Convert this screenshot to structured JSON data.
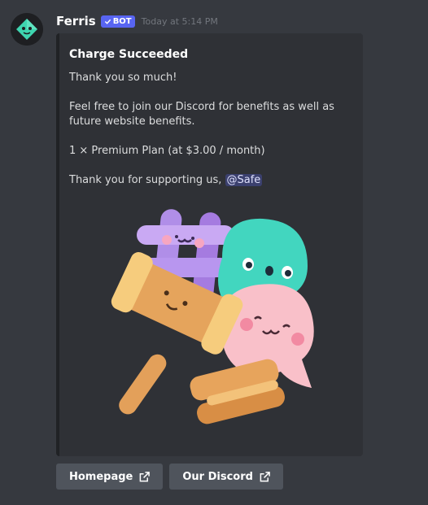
{
  "message": {
    "author": "Ferris",
    "bot_tag": "BOT",
    "timestamp": "Today at 5:14 PM"
  },
  "embed": {
    "title": "Charge Succeeded",
    "desc_thanks": "Thank you so much!",
    "desc_join": "Feel free to join our Discord for benefits as well as future website benefits.",
    "desc_plan": "1 × Premium Plan (at $3.00 / month)",
    "desc_support": "Thank you for supporting us, ",
    "mention": "@Safe"
  },
  "buttons": {
    "homepage_label": "Homepage",
    "discord_label": "Our Discord"
  },
  "icons": {
    "avatar": "ferris-bot-avatar-icon",
    "external_link": "external-link-icon",
    "verified_check": "check-icon"
  },
  "colors": {
    "background": "#36393f",
    "embed_bg": "#2f3136",
    "bot_tag": "#5865f2",
    "button": "#4f545c"
  }
}
